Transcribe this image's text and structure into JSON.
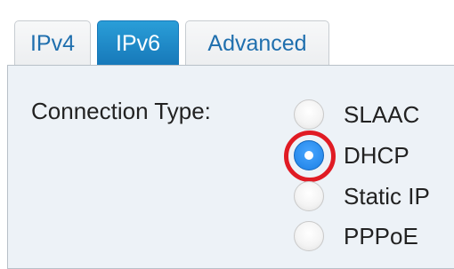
{
  "tabs": [
    {
      "label": "IPv4",
      "active": false
    },
    {
      "label": "IPv6",
      "active": true
    },
    {
      "label": "Advanced",
      "active": false
    }
  ],
  "form": {
    "connection_type_label": "Connection Type:",
    "options": [
      {
        "label": "SLAAC",
        "checked": false
      },
      {
        "label": "DHCP",
        "checked": true,
        "highlighted": true
      },
      {
        "label": "Static IP",
        "checked": false
      },
      {
        "label": "PPPoE",
        "checked": false
      }
    ]
  },
  "colors": {
    "tab_active_bg": "#1677b8",
    "tab_text": "#1f6fae",
    "panel_bg": "#edf2f7",
    "radio_checked": "#1b7fe4",
    "highlight_ring": "#e01b24"
  }
}
